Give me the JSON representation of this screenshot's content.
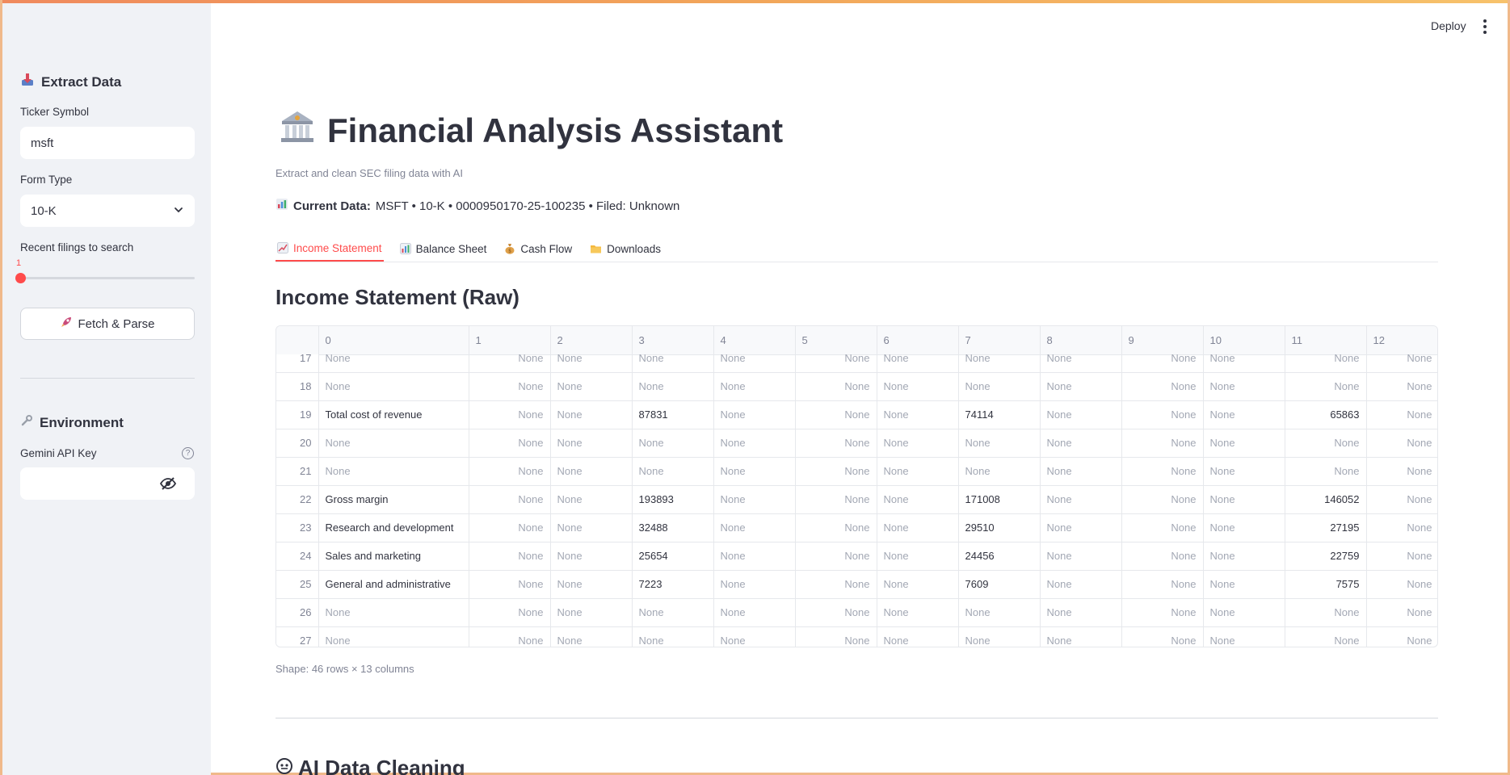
{
  "header": {
    "deploy_label": "Deploy"
  },
  "sidebar": {
    "extract_title": "Extract Data",
    "ticker_label": "Ticker Symbol",
    "ticker_value": "msft",
    "form_label": "Form Type",
    "form_value": "10-K",
    "filings_label": "Recent filings to search",
    "filings_value": "1",
    "fetch_label": "Fetch & Parse",
    "env_title": "Environment",
    "api_key_label": "Gemini API Key",
    "api_key_value": ""
  },
  "main": {
    "title": "Financial Analysis Assistant",
    "subtitle": "Extract and clean SEC filing data with AI",
    "current_label": "Current Data:",
    "current_value": "MSFT • 10-K • 0000950170-25-100235 • Filed: Unknown",
    "tabs": [
      {
        "label": "Income Statement",
        "icon": "chart-up-icon"
      },
      {
        "label": "Balance Sheet",
        "icon": "bar-chart-icon"
      },
      {
        "label": "Cash Flow",
        "icon": "money-bag-icon"
      },
      {
        "label": "Downloads",
        "icon": "folder-icon"
      }
    ],
    "section_title": "Income Statement (Raw)",
    "shape_text": "Shape: 46 rows × 13 columns",
    "ai_title": "AI Data Cleaning"
  },
  "table": {
    "columns": [
      "0",
      "1",
      "2",
      "3",
      "4",
      "5",
      "6",
      "7",
      "8",
      "9",
      "10",
      "11",
      "12"
    ],
    "rows": [
      {
        "idx": "17",
        "cells": [
          "None",
          "None",
          "None",
          "None",
          "None",
          "None",
          "None",
          "None",
          "None",
          "None",
          "None",
          "None",
          "None"
        ]
      },
      {
        "idx": "18",
        "cells": [
          "None",
          "None",
          "None",
          "None",
          "None",
          "None",
          "None",
          "None",
          "None",
          "None",
          "None",
          "None",
          "None"
        ]
      },
      {
        "idx": "19",
        "cells": [
          "Total cost of revenue",
          "None",
          "None",
          "87831",
          "None",
          "None",
          "None",
          "74114",
          "None",
          "None",
          "None",
          "65863",
          "None"
        ]
      },
      {
        "idx": "20",
        "cells": [
          "None",
          "None",
          "None",
          "None",
          "None",
          "None",
          "None",
          "None",
          "None",
          "None",
          "None",
          "None",
          "None"
        ]
      },
      {
        "idx": "21",
        "cells": [
          "None",
          "None",
          "None",
          "None",
          "None",
          "None",
          "None",
          "None",
          "None",
          "None",
          "None",
          "None",
          "None"
        ]
      },
      {
        "idx": "22",
        "cells": [
          "Gross margin",
          "None",
          "None",
          "193893",
          "None",
          "None",
          "None",
          "171008",
          "None",
          "None",
          "None",
          "146052",
          "None"
        ]
      },
      {
        "idx": "23",
        "cells": [
          "Research and development",
          "None",
          "None",
          "32488",
          "None",
          "None",
          "None",
          "29510",
          "None",
          "None",
          "None",
          "27195",
          "None"
        ]
      },
      {
        "idx": "24",
        "cells": [
          "Sales and marketing",
          "None",
          "None",
          "25654",
          "None",
          "None",
          "None",
          "24456",
          "None",
          "None",
          "None",
          "22759",
          "None"
        ]
      },
      {
        "idx": "25",
        "cells": [
          "General and administrative",
          "None",
          "None",
          "7223",
          "None",
          "None",
          "None",
          "7609",
          "None",
          "None",
          "None",
          "7575",
          "None"
        ]
      },
      {
        "idx": "26",
        "cells": [
          "None",
          "None",
          "None",
          "None",
          "None",
          "None",
          "None",
          "None",
          "None",
          "None",
          "None",
          "None",
          "None"
        ]
      },
      {
        "idx": "27",
        "cells": [
          "None",
          "None",
          "None",
          "None",
          "None",
          "None",
          "None",
          "None",
          "None",
          "None",
          "None",
          "None",
          "None"
        ]
      }
    ]
  }
}
